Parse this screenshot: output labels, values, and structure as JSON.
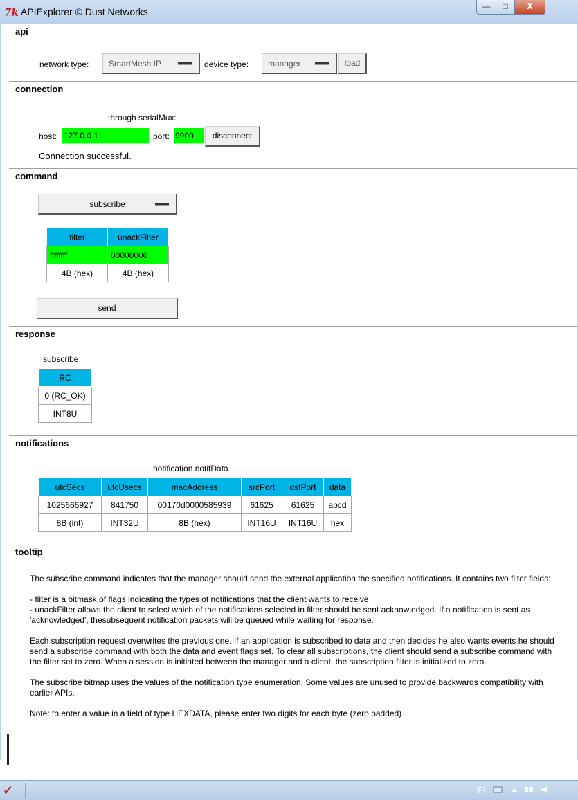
{
  "window": {
    "title": "APIExplorer © Dust Networks",
    "minimize": "—",
    "maximize": "□",
    "close": "X"
  },
  "api": {
    "section_title": "api",
    "network_type_label": "network type:",
    "network_type_value": "SmartMesh IP",
    "device_type_label": "device type:",
    "device_type_value": "manager",
    "load_label": "load"
  },
  "connection": {
    "section_title": "connection",
    "through_label": "through serialMux:",
    "host_label": "host:",
    "host_value": "127.0.0.1",
    "port_label": "port:",
    "port_value": "9900",
    "disconnect_label": "disconnect",
    "status": "Connection successful."
  },
  "command": {
    "section_title": "command",
    "selected_command": "subscribe",
    "columns": [
      "filter",
      "unackFilter"
    ],
    "values": [
      "ffffffff",
      "00000000"
    ],
    "formats": [
      "4B (hex)",
      "4B (hex)"
    ],
    "send_label": "send"
  },
  "response": {
    "section_title": "response",
    "table_title": "subscribe",
    "columns": [
      "RC"
    ],
    "values": [
      "0 (RC_OK)"
    ],
    "formats": [
      "INT8U"
    ]
  },
  "notifications": {
    "section_title": "notifications",
    "table_title": "notification.notifData",
    "columns": [
      "utcSecs",
      "utcUsecs",
      "macAddress",
      "srcPort",
      "dstPort",
      "data"
    ],
    "values": [
      "1025666927",
      "841750",
      "00170d0000585939",
      "61625",
      "61625",
      "abcd"
    ],
    "formats": [
      "8B (int)",
      "INT32U",
      "8B (hex)",
      "INT16U",
      "INT16U",
      "hex"
    ]
  },
  "tooltip": {
    "section_title": "tooltip",
    "paragraphs": [
      "The subscribe command indicates that the manager should send the external application the specified notifications. It contains two filter fields:",
      "- filter is a bitmask of flags indicating the types of notifications that the client wants to receive\n- unackFilter allows the client to select which of the notifications selected in filter should be sent acknowledged. If a notification is sent as 'acknowledged', thesubsequent notification packets will be queued while waiting for response.",
      "Each subscription request overwrites the previous one. If an application is subscribed to data and then decides he also wants events he should send a subscribe command with both the data and event flags set. To clear all subscriptions, the client should send a subscribe command with the filter set to zero. When a session is initiated between the manager and a client, the subscription filter is initialized to zero.",
      "The subscribe bitmap uses the values of the notification type enumeration. Some values are unused to provide backwards compatibility with earlier APIs.",
      "Note: to enter a value in a field of type HEXDATA, please enter two digits for each byte (zero padded)."
    ]
  },
  "taskbar": {
    "language": "FI"
  },
  "colors": {
    "header_cell": "#00b4e6",
    "active_field": "#00ff00",
    "title_bar": "#b9d1ec"
  },
  "icons": [
    "tk-icon",
    "tk-start-icon",
    "network-tray-icon",
    "flag-tray-icon",
    "volume-tray-icon"
  ]
}
